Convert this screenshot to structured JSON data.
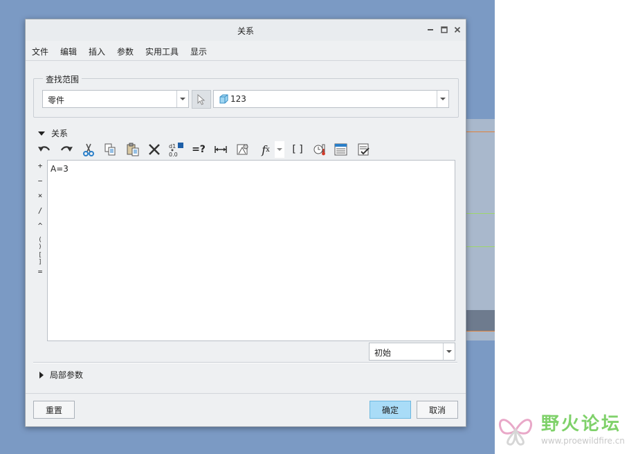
{
  "dialog": {
    "title": "关系",
    "window_controls": [
      "minimize-icon",
      "maximize-icon",
      "close-icon"
    ]
  },
  "menu": [
    "文件",
    "编辑",
    "插入",
    "参数",
    "实用工具",
    "显示"
  ],
  "lookup": {
    "group_label": "查找范围",
    "scope_value": "零件",
    "model_value": "123"
  },
  "relations": {
    "section_label": "关系",
    "toolbar": [
      "undo-icon",
      "redo-icon",
      "cut-icon",
      "copy-icon",
      "paste-icon",
      "delete-icon",
      "switch-dims-icon",
      "evaluate-icon",
      "show-dimension-icon",
      "insert-function-icon",
      "function-dropdown-icon",
      "insert-parameter-bracket-icon",
      "unit-sensitive-icon",
      "sort-relations-icon",
      "verify-relations-icon"
    ],
    "toolbar_text": {
      "dims_top": "d1",
      "dims_bottom": "0.0",
      "evaluate": "=?",
      "fx": "f",
      "fx_sub": "x",
      "brackets": "[ ]"
    },
    "operators": [
      "+",
      "−",
      "×",
      "/",
      "^",
      "( )",
      "[ ]",
      "="
    ],
    "content": "A=3",
    "state_value": "初始"
  },
  "local_params": {
    "section_label": "局部参数"
  },
  "buttons": {
    "reset": "重置",
    "ok": "确定",
    "cancel": "取消"
  },
  "watermark": {
    "title": "野火论坛",
    "url": "www.proewildfire.cn"
  }
}
